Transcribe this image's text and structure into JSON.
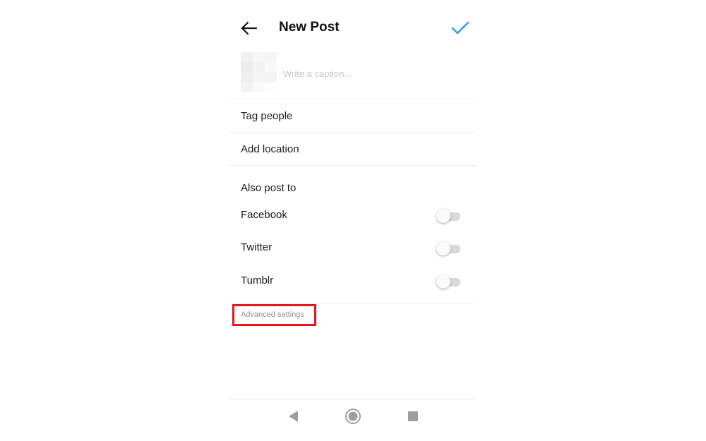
{
  "header": {
    "title": "New Post",
    "back_icon": "arrow-left-icon",
    "confirm_icon": "checkmark-icon",
    "confirm_color": "#3897f0"
  },
  "caption": {
    "value": "",
    "placeholder": "Write a caption..."
  },
  "options": {
    "tag_people": "Tag people",
    "add_location": "Add location"
  },
  "share": {
    "heading": "Also post to",
    "targets": [
      {
        "label": "Facebook",
        "enabled": false
      },
      {
        "label": "Twitter",
        "enabled": false
      },
      {
        "label": "Tumblr",
        "enabled": false
      }
    ]
  },
  "advanced": {
    "label": "Advanced settings",
    "highlight_color": "#e8141e"
  },
  "system_nav": {
    "back_icon": "triangle-back-icon",
    "home_icon": "circle-home-icon",
    "recents_icon": "square-recents-icon"
  }
}
